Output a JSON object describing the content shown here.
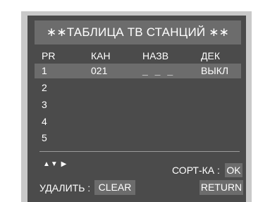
{
  "title": "∗∗ТАБЛИЦА ТВ СТАНЦИЙ ∗∗",
  "table": {
    "headers": {
      "pr": "PR",
      "kan": "КАН",
      "nazv": "НАЗВ",
      "dek": "ДЕК"
    },
    "rows": [
      {
        "pr": "1",
        "kan": "021",
        "nazv": "_ _ _",
        "dek": "ВЫКЛ"
      },
      {
        "pr": "2",
        "kan": "",
        "nazv": "",
        "dek": ""
      },
      {
        "pr": "3",
        "kan": "",
        "nazv": "",
        "dek": ""
      },
      {
        "pr": "4",
        "kan": "",
        "nazv": "",
        "dek": ""
      },
      {
        "pr": "5",
        "kan": "",
        "nazv": "",
        "dek": ""
      }
    ]
  },
  "footer": {
    "nav_arrows": "▲▼ ▶",
    "sort_label": "СОРТ-КА :",
    "ok_button": "OK",
    "delete_label": "УДАЛИТЬ :",
    "clear_button": "CLEAR",
    "return_button": "RETURN"
  },
  "colors": {
    "screen_bg": "#4b4b4b",
    "highlight": "#6c6c6c",
    "bezel": "#c9c9c9",
    "text": "#ffffff"
  }
}
